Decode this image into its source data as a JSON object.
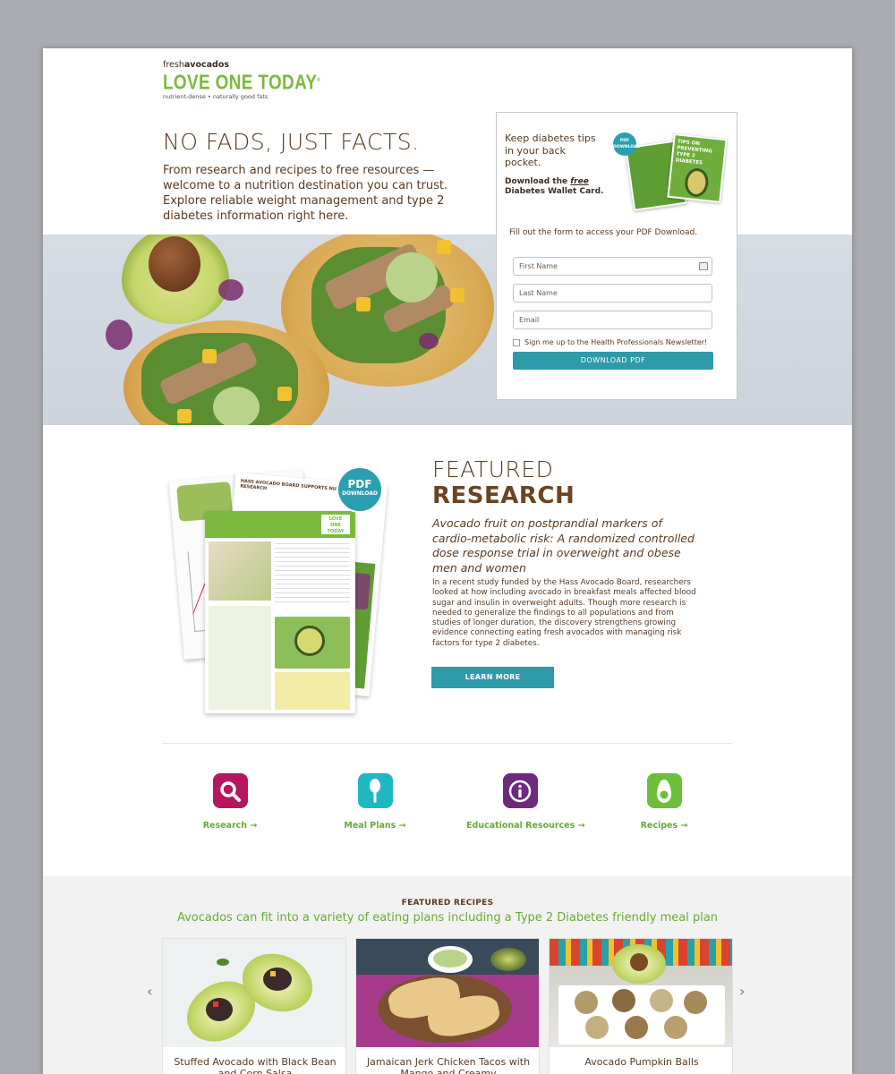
{
  "logo": {
    "fresh_prefix": "fresh",
    "fresh_bold": "avocados",
    "main": "LOVE ONE TODAY",
    "reg": "®",
    "tagline": "nutrient-dense • naturally good fats"
  },
  "hero": {
    "title": "NO FADS, JUST FACTS.",
    "description": "From research and recipes to free resources — welcome to a nutrition destination you can trust. Explore reliable weight management and type 2 diabetes information right here."
  },
  "form": {
    "promo_text": "Keep diabetes tips in your back pocket.",
    "download_prefix": "Download the ",
    "download_free": "free",
    "download_suffix": " Diabetes Wallet Card.",
    "badge": "PDF DOWNLOAD",
    "card_title": "TIPS ON PREVENTING TYPE 2 DIABETES",
    "note": "Fill out the form to access your PDF Download.",
    "first_name_placeholder": "First Name",
    "last_name_placeholder": "Last Name",
    "email_placeholder": "Email",
    "newsletter_label": "Sign me up to the Health Professionals Newsletter!",
    "submit_label": "DOWNLOAD PDF"
  },
  "research": {
    "badge_big": "PDF",
    "badge_small": "DOWNLOAD",
    "doc_header": "HASS AVOCADO BOARD SUPPORTS NUTRITION RESEARCH",
    "title_light": "FEATURED",
    "title_bold": "RESEARCH",
    "subtitle": "Avocado fruit on postprandial markers of cardio-metabolic risk: A randomized controlled dose response trial in overweight and obese men and women",
    "body": "In a recent study funded by the Hass Avocado Board, researchers looked at how including avocado in breakfast meals affected blood sugar and insulin in overweight adults. Though more research is needed to generalize the findings to all populations and from studies of longer duration, the discovery strengthens growing evidence connecting eating fresh avocados with managing risk factors for type 2 diabetes.",
    "cta": "LEARN MORE"
  },
  "categories": [
    {
      "label": "Research →",
      "icon": "magnifier-icon",
      "color": "#b5165e"
    },
    {
      "label": "Meal Plans →",
      "icon": "spoon-icon",
      "color": "#1fb7c4"
    },
    {
      "label": "Educational Resources →",
      "icon": "info-icon",
      "color": "#6d2a7f"
    },
    {
      "label": "Recipes →",
      "icon": "avocado-icon",
      "color": "#6cbf3a"
    }
  ],
  "recipes": {
    "heading": "FEATURED RECIPES",
    "subheading": "Avocados can fit into a variety of eating plans including a Type 2 Diabetes friendly meal plan",
    "items": [
      {
        "title": "Stuffed Avocado with Black Bean and Corn Salsa"
      },
      {
        "title": "Jamaican Jerk Chicken Tacos with Mango and Creamy"
      },
      {
        "title": "Avocado Pumpkin Balls"
      }
    ],
    "prev": "‹",
    "next": "›"
  },
  "colors": {
    "brand_green": "#7bba3e",
    "brown": "#5b3a1f",
    "teal_button": "#2e9aaa"
  }
}
